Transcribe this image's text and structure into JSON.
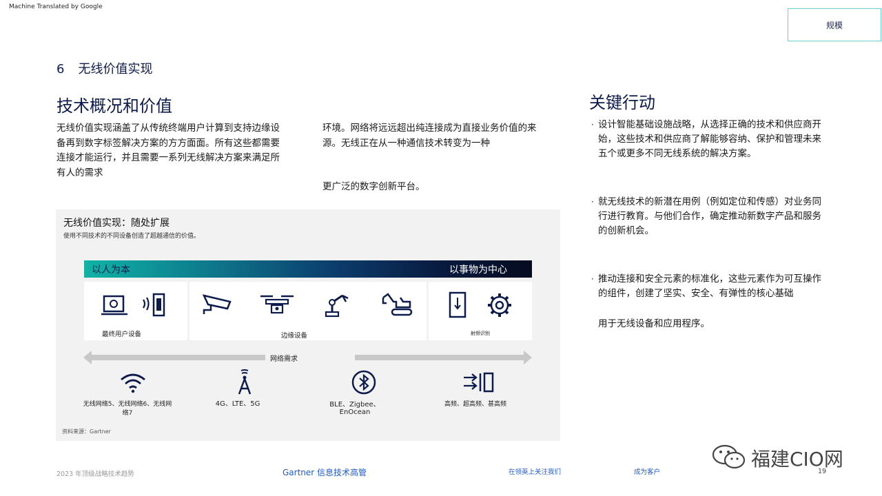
{
  "header": {
    "machine_translated": "Machine Translated by Google",
    "scale_label": "规模"
  },
  "section": {
    "number": "6",
    "title": "无线价值实现"
  },
  "left": {
    "heading": "技术概况和价值",
    "para1": "无线价值实现涵盖了从传统终端用户计算到支持边缘设备再到数字标签解决方案的方方面面。所有这些都需要连接才能运行，并且需要一系列无线解决方案来满足所有人的需求",
    "para2": "环境。网络将远远超出纯连接成为直接业务价值的来源。无线正在从一种通信技术转变为一种",
    "para3": "更广泛的数字创新平台。"
  },
  "right": {
    "heading": "关键行动",
    "bullets": [
      "设计智能基础设施战略，从选择正确的技术和供应商开始，这些技术和供应商了解能够容纳、保护和管理未来五个或更多不同无线系统的解决方案。",
      "就无线技术的新潜在用例（例如定位和传感）对业务同行进行教育。与他们合作，确定推动新数字产品和服务的创新机会。",
      "推动连接和安全元素的标准化，这些元素作为可互操作的组件，创建了坚实、安全、有弹性的核心基础"
    ],
    "bullet3_cont": "用于无线设备和应用程序。"
  },
  "figure": {
    "title": "无线价值实现：随处扩展",
    "subtitle": "使用不同技术的不同设备创造了超越通信的价值。",
    "gradient_left": "以人为本",
    "gradient_right": "以事物为中心",
    "device_groups": [
      "最终用户设备",
      "边缘设备",
      "射频识别"
    ],
    "network_needs": "网络需求",
    "networks": [
      "无线网络5、无线网络6、无线网络7",
      "4G、LTE、5G",
      "BLE、Zigbee、EnOcean",
      "高频、超高频、甚高频"
    ],
    "source": "资料来源：Gartner",
    "icons": [
      "laptop-icon",
      "phone-signal-icon",
      "camera-icon",
      "drone-icon",
      "robot-arm-icon",
      "excavator-icon",
      "tag-icon",
      "gear-icon",
      "wifi-icon",
      "cell-tower-icon",
      "bluetooth-icon",
      "radio-signal-icon"
    ]
  },
  "footer": {
    "left": "2023 年顶级战略技术趋势",
    "center": "Gartner 信息技术高管",
    "follow": "在领英上关注我们",
    "customer": "成为客户",
    "page": "19",
    "watermark": "福建CIO网"
  },
  "colors": {
    "navy": "#0d1b4c",
    "teal": "#10b3a5",
    "link": "#1f5bc6",
    "icon": "#0d1b4c"
  }
}
